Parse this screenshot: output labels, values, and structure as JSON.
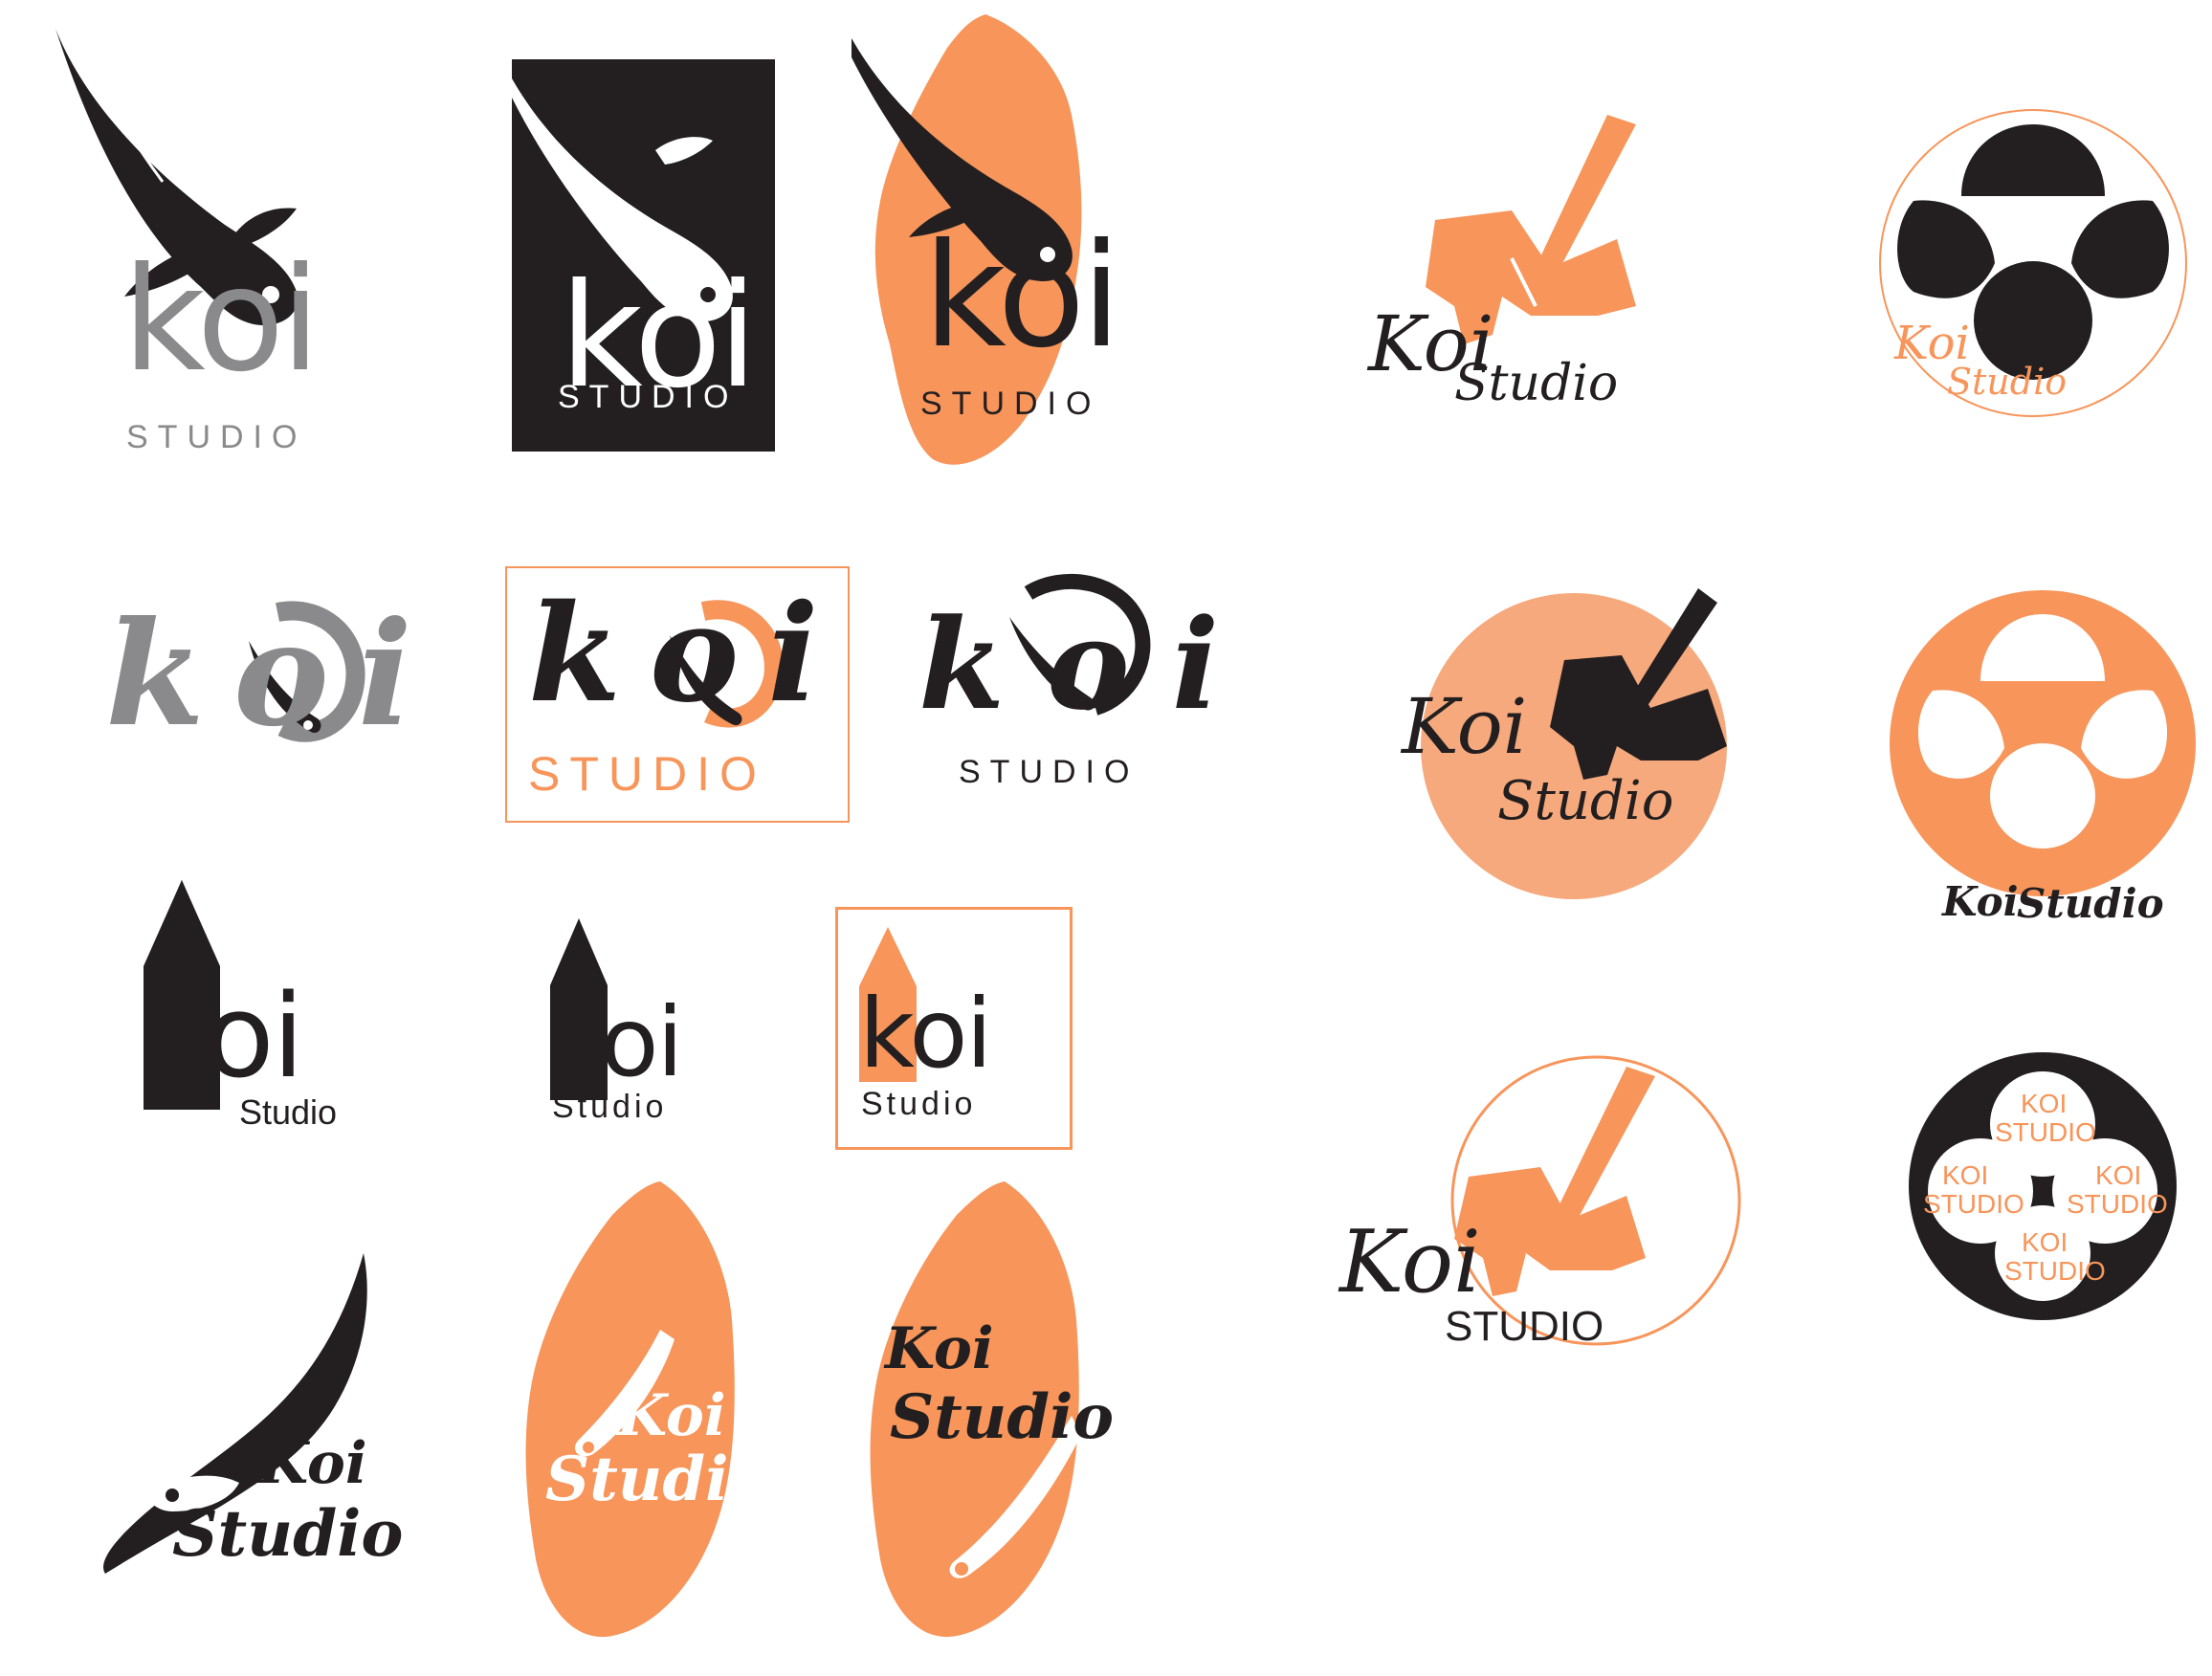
{
  "colors": {
    "black": "#231f20",
    "gray": "#8a8a8c",
    "orange": "#f7955a",
    "light_orange": "#f6a97c",
    "white": "#ffffff"
  },
  "logos": {
    "l1": {
      "koi": "koi",
      "studio": "STUDIO"
    },
    "l2": {
      "koi": "koi",
      "studio": "STUDIO"
    },
    "l3": {
      "koi": "koi",
      "studio": "STUDIO"
    },
    "l4": {
      "koi": "koi"
    },
    "l5": {
      "koi": "koi",
      "studio": "STUDIO"
    },
    "l6": {
      "koi": "koi",
      "studio": "STUDIO"
    },
    "l7": {
      "koi": "koi",
      "studio": "Studio"
    },
    "l8": {
      "koi": "koi",
      "studio": "Studio"
    },
    "l9": {
      "koi": "koi",
      "studio": "Studio"
    },
    "l10": {
      "koi": "Koi",
      "studio": "Studio"
    },
    "l11": {
      "koi": "Koi",
      "studio": "Studio"
    },
    "l12": {
      "koi": "Koi",
      "studio": "Studio"
    },
    "r1": {
      "koi": "Koi",
      "studio": "Studio"
    },
    "r2": {
      "koi": "Koi",
      "studio": "Studio"
    },
    "r3": {
      "koi": "Koi",
      "studio": "Studio"
    },
    "r4": {
      "koi": "Koi",
      "studio": "Studio"
    },
    "r5": {
      "koi": "Koi",
      "studio": "STUDIO"
    },
    "r6": {
      "pattern_koi": "KOI",
      "pattern_studio": "STUDIO"
    }
  }
}
